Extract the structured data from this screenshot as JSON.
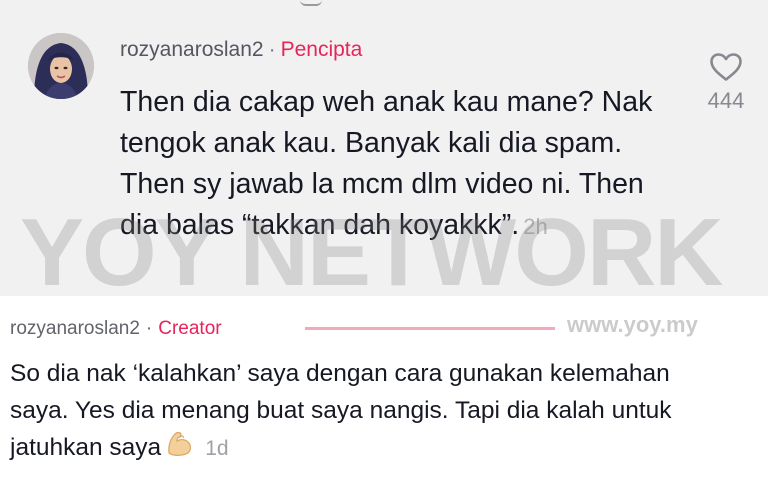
{
  "reply1": {
    "username": "rozyanaroslan2",
    "separator": "·",
    "role": "Pencipta",
    "text": "Then dia cakap weh anak kau mane? Nak tengok anak kau. Banyak kali dia spam. Then sy jawab la mcm dlm video ni. Then dia balas “takkan dah koyakkk”.",
    "time": "2h",
    "like_count": "444",
    "like_icon": "heart-outline-icon"
  },
  "reply2": {
    "username": "rozyanaroslan2",
    "separator": "·",
    "role": "Creator",
    "text": "So dia nak ‘kalahkan’ saya dengan cara gunakan kelemahan saya. Yes dia menang buat saya nangis. Tapi dia kalah untuk jatuhkan saya",
    "emoji_icon": "flexed-biceps-icon",
    "time": "1d"
  },
  "watermark": {
    "text": "YOY NETWORK",
    "url": "www.yoy.my"
  },
  "colors": {
    "accent": "#e8245a",
    "panel_bg": "#f1f1f2",
    "text": "#161823",
    "muted": "#88898e"
  }
}
